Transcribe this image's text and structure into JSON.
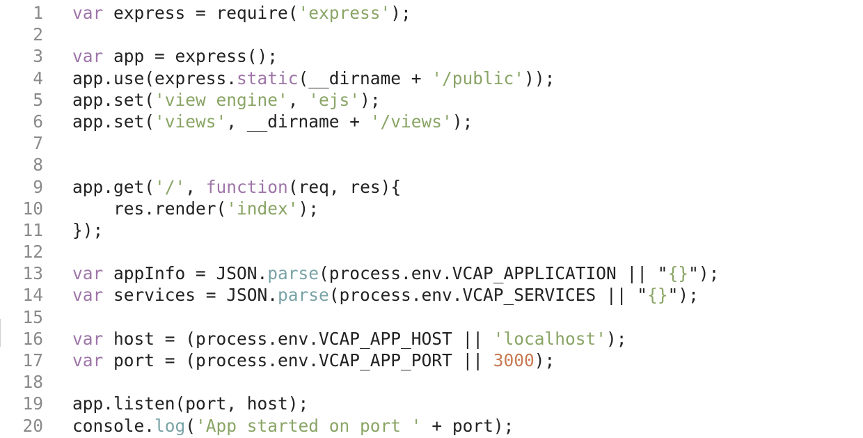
{
  "editor": {
    "colors": {
      "background": "#ffffff",
      "line_number": "#8a8a8a",
      "plain": "#222222",
      "keyword": "#9e75a8",
      "string": "#8aa566",
      "number": "#c87a52",
      "builtin_method": "#7aa3a6"
    },
    "lines": [
      {
        "number": "1",
        "tokens": [
          {
            "t": "var",
            "k": "kw"
          },
          {
            "t": " express = require(",
            "k": "pl"
          },
          {
            "t": "'express'",
            "k": "str"
          },
          {
            "t": ");",
            "k": "pl"
          }
        ]
      },
      {
        "number": "2",
        "tokens": []
      },
      {
        "number": "3",
        "tokens": [
          {
            "t": "var",
            "k": "kw"
          },
          {
            "t": " app = express();",
            "k": "pl"
          }
        ]
      },
      {
        "number": "4",
        "tokens": [
          {
            "t": "app.use(express.",
            "k": "pl"
          },
          {
            "t": "static",
            "k": "kw"
          },
          {
            "t": "(__dirname + ",
            "k": "pl"
          },
          {
            "t": "'/public'",
            "k": "str"
          },
          {
            "t": "));",
            "k": "pl"
          }
        ]
      },
      {
        "number": "5",
        "tokens": [
          {
            "t": "app.set(",
            "k": "pl"
          },
          {
            "t": "'view engine'",
            "k": "str"
          },
          {
            "t": ", ",
            "k": "pl"
          },
          {
            "t": "'ejs'",
            "k": "str"
          },
          {
            "t": ");",
            "k": "pl"
          }
        ]
      },
      {
        "number": "6",
        "tokens": [
          {
            "t": "app.set(",
            "k": "pl"
          },
          {
            "t": "'views'",
            "k": "str"
          },
          {
            "t": ", __dirname + ",
            "k": "pl"
          },
          {
            "t": "'/views'",
            "k": "str"
          },
          {
            "t": ");",
            "k": "pl"
          }
        ]
      },
      {
        "number": "7",
        "tokens": []
      },
      {
        "number": "8",
        "tokens": []
      },
      {
        "number": "9",
        "tokens": [
          {
            "t": "app.get(",
            "k": "pl"
          },
          {
            "t": "'/'",
            "k": "str"
          },
          {
            "t": ", ",
            "k": "pl"
          },
          {
            "t": "function",
            "k": "kw"
          },
          {
            "t": "(req, res){",
            "k": "pl"
          }
        ]
      },
      {
        "number": "10",
        "tokens": [
          {
            "t": "    res.render(",
            "k": "pl"
          },
          {
            "t": "'index'",
            "k": "str"
          },
          {
            "t": ");",
            "k": "pl"
          }
        ]
      },
      {
        "number": "11",
        "tokens": [
          {
            "t": "});",
            "k": "pl"
          }
        ]
      },
      {
        "number": "12",
        "tokens": []
      },
      {
        "number": "13",
        "tokens": [
          {
            "t": "var",
            "k": "kw"
          },
          {
            "t": " appInfo = JSON.",
            "k": "pl"
          },
          {
            "t": "parse",
            "k": "fn"
          },
          {
            "t": "(process.env.VCAP_APPLICATION || \"",
            "k": "pl"
          },
          {
            "t": "{}",
            "k": "str"
          },
          {
            "t": "\");",
            "k": "pl"
          }
        ]
      },
      {
        "number": "14",
        "tokens": [
          {
            "t": "var",
            "k": "kw"
          },
          {
            "t": " services = JSON.",
            "k": "pl"
          },
          {
            "t": "parse",
            "k": "fn"
          },
          {
            "t": "(process.env.VCAP_SERVICES || \"",
            "k": "pl"
          },
          {
            "t": "{}",
            "k": "str"
          },
          {
            "t": "\");",
            "k": "pl"
          }
        ]
      },
      {
        "number": "15",
        "tokens": []
      },
      {
        "number": "16",
        "tokens": [
          {
            "t": "var",
            "k": "kw"
          },
          {
            "t": " host = (process.env.VCAP_APP_HOST || ",
            "k": "pl"
          },
          {
            "t": "'localhost'",
            "k": "str"
          },
          {
            "t": ");",
            "k": "pl"
          }
        ]
      },
      {
        "number": "17",
        "tokens": [
          {
            "t": "var",
            "k": "kw"
          },
          {
            "t": " port = (process.env.VCAP_APP_PORT || ",
            "k": "pl"
          },
          {
            "t": "3000",
            "k": "num"
          },
          {
            "t": ");",
            "k": "pl"
          }
        ]
      },
      {
        "number": "18",
        "tokens": []
      },
      {
        "number": "19",
        "tokens": [
          {
            "t": "app.listen(port, host);",
            "k": "pl"
          }
        ]
      },
      {
        "number": "20",
        "tokens": [
          {
            "t": "console.",
            "k": "pl"
          },
          {
            "t": "log",
            "k": "fn"
          },
          {
            "t": "(",
            "k": "pl"
          },
          {
            "t": "'App started on port '",
            "k": "str"
          },
          {
            "t": " + port);",
            "k": "pl"
          }
        ]
      }
    ]
  }
}
